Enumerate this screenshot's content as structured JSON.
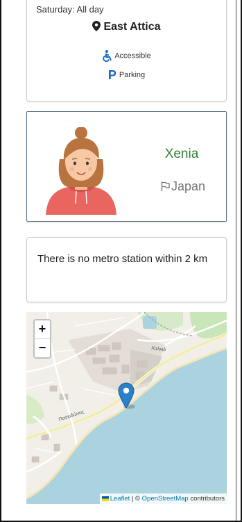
{
  "location_card": {
    "hours": "Saturday: All day",
    "area": "East Attica",
    "icons": {
      "area": "map-pin-icon",
      "accessible": "wheelchair-icon",
      "parking": "parking-icon"
    },
    "features": {
      "accessible": "Accessible",
      "parking": "Parking"
    }
  },
  "host_card": {
    "name": "Xenia",
    "country": "Japan",
    "icons": {
      "avatar": "woman-avatar",
      "country": "flag-icon"
    }
  },
  "metro_card": {
    "text": "There is no metro station within 2 km"
  },
  "map": {
    "zoom_in": "+",
    "zoom_out": "−",
    "attribution": {
      "leaflet": "Leaflet",
      "sep": "|",
      "copyright": "©",
      "osm": "OpenStreetMap",
      "contributors": "contributors"
    },
    "road_labels": [
      "Χαλκιδ",
      "Ποσειδώνος"
    ],
    "colors": {
      "sea": "#aad3df",
      "land": "#f2efe9",
      "marker": "#2a81cb"
    }
  }
}
